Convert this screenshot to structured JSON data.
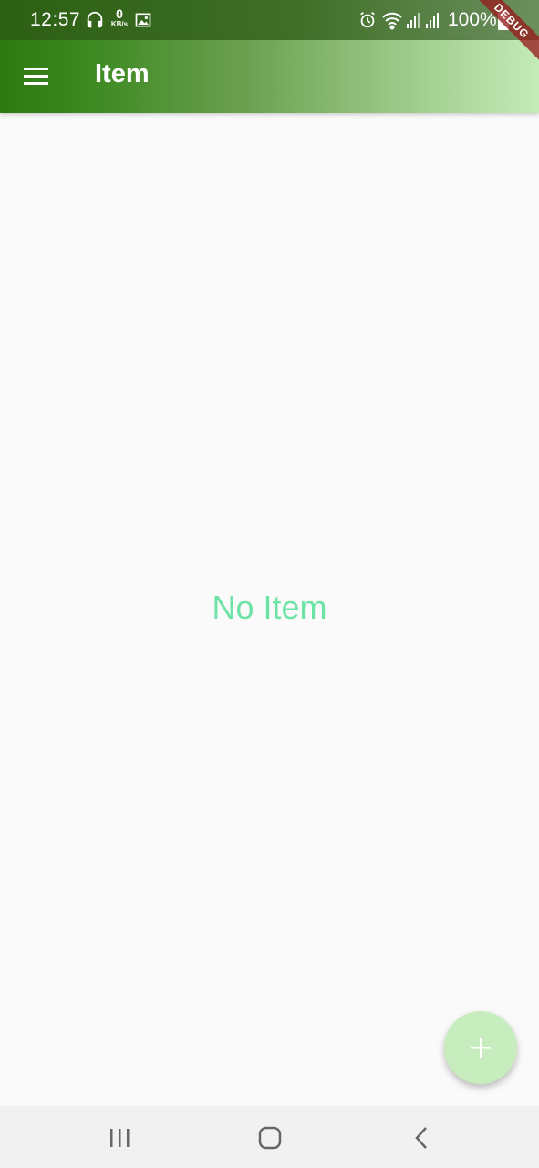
{
  "status_bar": {
    "time": "12:57",
    "network_speed": "0",
    "network_unit": "KB/s",
    "battery": "100%",
    "icons": [
      "headphones-icon",
      "image-icon",
      "alarm-icon",
      "wifi-icon",
      "signal-icon",
      "battery-icon"
    ]
  },
  "app_bar": {
    "title": "Item",
    "menu_icon": "hamburger-menu-icon"
  },
  "debug_banner": "DEBUG",
  "content": {
    "empty_message": "No Item"
  },
  "fab": {
    "icon": "plus-icon"
  },
  "nav_bar": {
    "icons": [
      "recents-icon",
      "home-icon",
      "back-icon"
    ]
  },
  "colors": {
    "app_bar_start": "#2c7a10",
    "app_bar_end": "#c4ebb8",
    "empty_text": "#6ee3a6",
    "fab_background": "#c7ecbd",
    "background": "#fafafa"
  }
}
